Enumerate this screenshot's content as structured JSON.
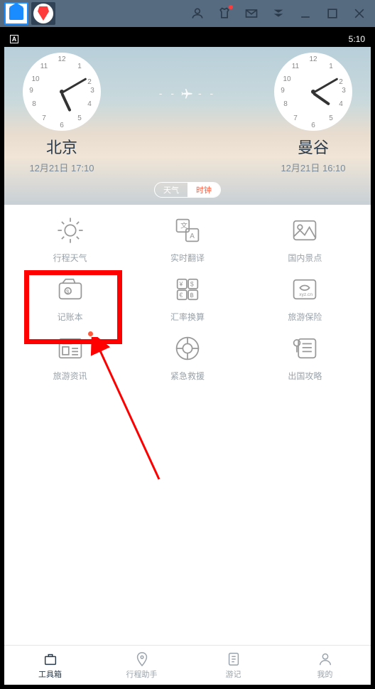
{
  "titlebar": {},
  "status": {
    "time": "5:10",
    "logo": "A"
  },
  "header": {
    "city1": {
      "name": "北京",
      "datetime": "12月21日 17:10"
    },
    "city2": {
      "name": "曼谷",
      "datetime": "12月21日 16:10"
    },
    "seg": {
      "left": "天气",
      "right": "时钟"
    }
  },
  "grid": {
    "labels": [
      "行程天气",
      "实时翻译",
      "国内景点",
      "记账本",
      "汇率换算",
      "旅游保险",
      "旅游资讯",
      "紧急救援",
      "出国攻略"
    ]
  },
  "nav": {
    "items": [
      "工具箱",
      "行程助手",
      "游记",
      "我的"
    ]
  }
}
